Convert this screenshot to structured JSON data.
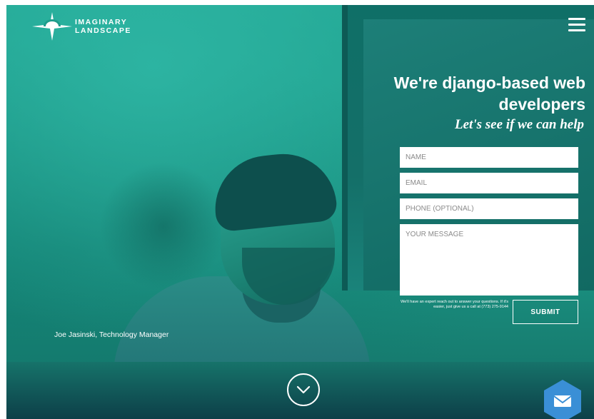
{
  "brand": {
    "name_line1": "IMAGINARY",
    "name_line2": "LANDSCAPE",
    "icon": "sunrise-star-logo-icon"
  },
  "header": {
    "menu_icon": "hamburger-menu-icon"
  },
  "hero": {
    "title": "We're django-based web developers",
    "subtitle": "Let's see if we can help"
  },
  "form": {
    "name_placeholder": "NAME",
    "email_placeholder": "EMAIL",
    "phone_placeholder": "PHONE (OPTIONAL)",
    "message_placeholder": "YOUR MESSAGE",
    "note": "We'll have an expert reach out to answer your questions. If it's easier, just give us a call at (773) 275-9144",
    "submit_label": "SUBMIT"
  },
  "photo_caption": "Joe Jasinski, Technology Manager",
  "scroll_icon": "chevron-down-icon",
  "contact_icon": "envelope-icon",
  "colors": {
    "teal": "#1e9d8c",
    "mail_badge": "#3a8fd6",
    "text": "#ffffff"
  }
}
